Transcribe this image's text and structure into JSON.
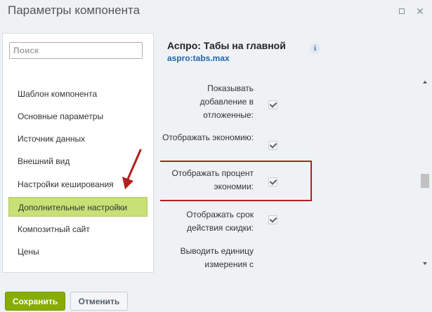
{
  "window": {
    "title": "Параметры компонента"
  },
  "sidebar": {
    "search_placeholder": "Поиск",
    "items": [
      {
        "label": "Шаблон компонента"
      },
      {
        "label": "Основные параметры"
      },
      {
        "label": "Источник данных"
      },
      {
        "label": "Внешний вид"
      },
      {
        "label": "Настройки кеширования"
      },
      {
        "label": "Дополнительные настройки",
        "active": true
      },
      {
        "label": "Композитный сайт"
      },
      {
        "label": "Цены"
      }
    ]
  },
  "content": {
    "title": "Аспро: Табы на главной",
    "subtitle": "aspro:tabs.max",
    "info_icon": "info-icon",
    "rows": [
      {
        "label": "Показывать добавление в отложенные:",
        "checked": true
      },
      {
        "label": "Отображать экономию:",
        "checked": true
      },
      {
        "label": "Отображать процент экономии:",
        "checked": true
      },
      {
        "label": "Отображать срок действия скидки:",
        "checked": true
      },
      {
        "label": "Выводить единицу измерения с",
        "checked": false
      }
    ]
  },
  "footer": {
    "save_label": "Сохранить",
    "cancel_label": "Отменить"
  },
  "colors": {
    "accent": "#86ad00",
    "active_item": "#c8e076",
    "highlight": "#b3201e",
    "link": "#2067b0"
  }
}
